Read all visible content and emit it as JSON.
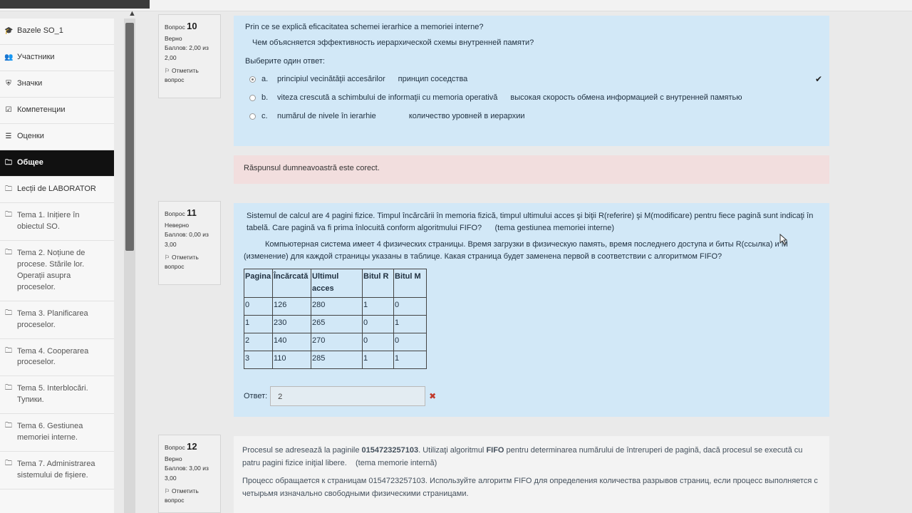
{
  "sidebar": {
    "items": [
      {
        "label": "Bazele SO_1",
        "icon": "graduation-cap-icon"
      },
      {
        "label": "Участники",
        "icon": "users-icon"
      },
      {
        "label": "Значки",
        "icon": "shield-icon"
      },
      {
        "label": "Компетенции",
        "icon": "checkbox-icon"
      },
      {
        "label": "Оценки",
        "icon": "table-icon"
      },
      {
        "label": "Общее",
        "icon": "folder-icon",
        "active": true
      },
      {
        "label": "Lecții de LABORATOR",
        "icon": "folder-icon"
      },
      {
        "label": "Tema 1. Inițiere în obiectul SO.",
        "icon": "folder-icon"
      },
      {
        "label": "Tema 2. Noțiune de procese. Stările lor. Operații asupra proceselor.",
        "icon": "folder-icon"
      },
      {
        "label": "Tema 3. Planificarea proceselor.",
        "icon": "folder-icon"
      },
      {
        "label": "Tema 4. Cooperarea proceselor.",
        "icon": "folder-icon"
      },
      {
        "label": "Tema 5. Interblocări. Тупики.",
        "icon": "folder-icon"
      },
      {
        "label": "Tema 6. Gestiunea memoriei interne.",
        "icon": "folder-icon"
      },
      {
        "label": "Tema 7. Administrarea sistemului de fișiere.",
        "icon": "folder-icon"
      }
    ]
  },
  "q10": {
    "info": {
      "label": "Вопрос",
      "number": "10",
      "status": "Верно",
      "grade": "Баллов: 2,00 из 2,00",
      "flag": "Отметить вопрос"
    },
    "text_ro": "Prin ce se explică eficacitatea schemei ierarhice a memoriei interne?",
    "text_ru": "Чем объясняется эффективность иерархической схемы внутренней памяти?",
    "answer_prompt": "Выберите один ответ:",
    "options": [
      {
        "letter": "a.",
        "ro": "principiul vecinătăţii accesărilor",
        "ru": "принцип соседства",
        "checked": true,
        "correct": true
      },
      {
        "letter": "b.",
        "ro": "viteza crescută a schimbului de informaţii cu memoria operativă",
        "ru": "высокая скорость обмена информацией с внутренней памятью"
      },
      {
        "letter": "c.",
        "ro": "numărul de nivele în ierarhie",
        "ru": "количество уровней в иерархии"
      }
    ],
    "feedback": "Răspunsul dumneavoastră este corect."
  },
  "q11": {
    "info": {
      "label": "Вопрос",
      "number": "11",
      "status": "Неверно",
      "grade": "Баллов: 0,00 из 3,00",
      "flag": "Отметить вопрос"
    },
    "text_ro": "Sistemul de calcul are 4 pagini fizice. Timpul încărcării în memoria fizică, timpul ultimului acces şi biţii R(referire) şi M(modificare) pentru fiece pagină sunt indicaţi în tabelă. Care pagină va fi prima înlocuită conform algoritmului FIFO?",
    "topic": "(tema gestiunea memoriei interne)",
    "text_ru": "Компьютерная система имеет 4 физических страницы. Время загрузки в физическую память, время последнего доступа и биты R(ссылка) и M (изменение) для каждой страницы указаны в таблице. Какая страница будет заменена первой в соответствии с алгоритмом FIFO?",
    "table": {
      "headers": [
        "Pagina",
        "Încărcată",
        "Ultimul acces",
        "Bitul R",
        "Bitul M"
      ],
      "rows": [
        [
          "0",
          "126",
          "280",
          "1",
          "0"
        ],
        [
          "1",
          "230",
          "265",
          "0",
          "1"
        ],
        [
          "2",
          "140",
          "270",
          "0",
          "0"
        ],
        [
          "3",
          "110",
          "285",
          "1",
          "1"
        ]
      ]
    },
    "answer_label": "Ответ:",
    "answer_value": "2"
  },
  "q12": {
    "info": {
      "label": "Вопрос",
      "number": "12",
      "status": "Верно",
      "grade": "Баллов: 3,00 из 3,00",
      "flag": "Отметить вопрос"
    },
    "ro_part1": "Procesul se adresează la paginile ",
    "ro_seq": "0154723257103",
    "ro_part2": ". Utilizaţi algoritmul ",
    "ro_algo": "FIFO",
    "ro_part3": " pentru determinarea numărului de întreruperi de pagină, dacă procesul se execută cu patru pagini fizice iniţial libere.",
    "ro_topic": "(tema memorie internă)",
    "text_ru": "Процесс обращается к страницам 0154723257103. Используйте алгоритм FIFO для определения количества разрывов страниц, если процесс выполняется с четырьмя изначально свободными физическими страницами."
  }
}
